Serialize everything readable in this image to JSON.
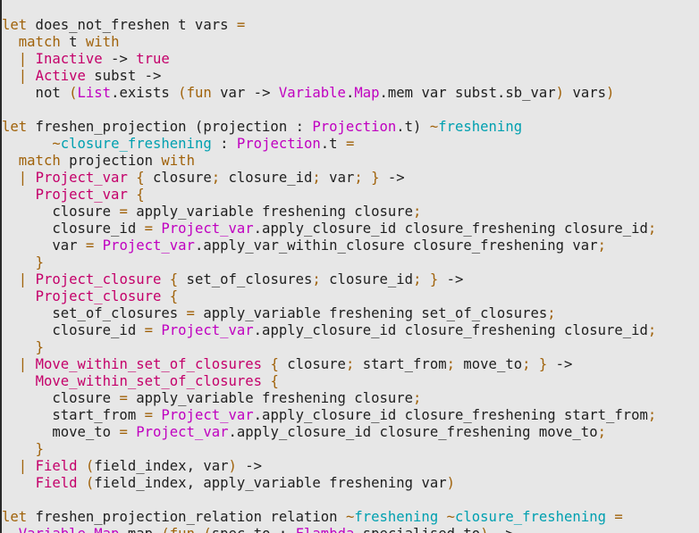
{
  "editor": {
    "title": "",
    "colors": {
      "background": "#e7e7e7",
      "keyword": "#a0620a",
      "constructor": "#c4006a",
      "module": "#c000c0",
      "label": "#00a0b0",
      "plain": "#202020"
    },
    "lines": [
      [
        [
          "kw",
          "let"
        ],
        [
          "plain",
          " does_not_freshen t vars "
        ],
        [
          "kw",
          "="
        ]
      ],
      [
        [
          "plain",
          "  "
        ],
        [
          "kw",
          "match"
        ],
        [
          "plain",
          " t "
        ],
        [
          "kw",
          "with"
        ]
      ],
      [
        [
          "plain",
          "  "
        ],
        [
          "kw",
          "|"
        ],
        [
          "plain",
          " "
        ],
        [
          "ctor",
          "Inactive"
        ],
        [
          "plain",
          " -> "
        ],
        [
          "ctor",
          "true"
        ]
      ],
      [
        [
          "plain",
          "  "
        ],
        [
          "kw",
          "|"
        ],
        [
          "plain",
          " "
        ],
        [
          "ctor",
          "Active"
        ],
        [
          "plain",
          " subst ->"
        ]
      ],
      [
        [
          "plain",
          "    not "
        ],
        [
          "kw",
          "("
        ],
        [
          "mod",
          "List"
        ],
        [
          "plain",
          ".exists "
        ],
        [
          "kw",
          "("
        ],
        [
          "kw",
          "fun"
        ],
        [
          "plain",
          " var -> "
        ],
        [
          "mod",
          "Variable"
        ],
        [
          "plain",
          "."
        ],
        [
          "mod",
          "Map"
        ],
        [
          "plain",
          ".mem var subst.sb_var"
        ],
        [
          "kw",
          ")"
        ],
        [
          "plain",
          " vars"
        ],
        [
          "kw",
          ")"
        ]
      ],
      [
        [
          "plain",
          ""
        ]
      ],
      [
        [
          "kw",
          "let"
        ],
        [
          "plain",
          " freshen_projection (projection : "
        ],
        [
          "mod",
          "Projection"
        ],
        [
          "plain",
          ".t) "
        ],
        [
          "kw",
          "~"
        ],
        [
          "label",
          "freshening"
        ]
      ],
      [
        [
          "plain",
          "      "
        ],
        [
          "kw",
          "~"
        ],
        [
          "label",
          "closure_freshening"
        ],
        [
          "plain",
          " : "
        ],
        [
          "mod",
          "Projection"
        ],
        [
          "plain",
          ".t "
        ],
        [
          "kw",
          "="
        ]
      ],
      [
        [
          "plain",
          "  "
        ],
        [
          "kw",
          "match"
        ],
        [
          "plain",
          " projection "
        ],
        [
          "kw",
          "with"
        ]
      ],
      [
        [
          "plain",
          "  "
        ],
        [
          "kw",
          "|"
        ],
        [
          "plain",
          " "
        ],
        [
          "ctor",
          "Project_var"
        ],
        [
          "plain",
          " "
        ],
        [
          "kw",
          "{"
        ],
        [
          "plain",
          " closure"
        ],
        [
          "kw",
          ";"
        ],
        [
          "plain",
          " closure_id"
        ],
        [
          "kw",
          ";"
        ],
        [
          "plain",
          " var"
        ],
        [
          "kw",
          ";"
        ],
        [
          "plain",
          " "
        ],
        [
          "kw",
          "}"
        ],
        [
          "plain",
          " ->"
        ]
      ],
      [
        [
          "plain",
          "    "
        ],
        [
          "ctor",
          "Project_var"
        ],
        [
          "plain",
          " "
        ],
        [
          "kw",
          "{"
        ]
      ],
      [
        [
          "plain",
          "      closure "
        ],
        [
          "kw",
          "="
        ],
        [
          "plain",
          " apply_variable freshening closure"
        ],
        [
          "kw",
          ";"
        ]
      ],
      [
        [
          "plain",
          "      closure_id "
        ],
        [
          "kw",
          "="
        ],
        [
          "plain",
          " "
        ],
        [
          "mod",
          "Project_var"
        ],
        [
          "plain",
          ".apply_closure_id closure_freshening closure_id"
        ],
        [
          "kw",
          ";"
        ]
      ],
      [
        [
          "plain",
          "      var "
        ],
        [
          "kw",
          "="
        ],
        [
          "plain",
          " "
        ],
        [
          "mod",
          "Project_var"
        ],
        [
          "plain",
          ".apply_var_within_closure closure_freshening var"
        ],
        [
          "kw",
          ";"
        ]
      ],
      [
        [
          "plain",
          "    "
        ],
        [
          "kw",
          "}"
        ]
      ],
      [
        [
          "plain",
          "  "
        ],
        [
          "kw",
          "|"
        ],
        [
          "plain",
          " "
        ],
        [
          "ctor",
          "Project_closure"
        ],
        [
          "plain",
          " "
        ],
        [
          "kw",
          "{"
        ],
        [
          "plain",
          " set_of_closures"
        ],
        [
          "kw",
          ";"
        ],
        [
          "plain",
          " closure_id"
        ],
        [
          "kw",
          ";"
        ],
        [
          "plain",
          " "
        ],
        [
          "kw",
          "}"
        ],
        [
          "plain",
          " ->"
        ]
      ],
      [
        [
          "plain",
          "    "
        ],
        [
          "ctor",
          "Project_closure"
        ],
        [
          "plain",
          " "
        ],
        [
          "kw",
          "{"
        ]
      ],
      [
        [
          "plain",
          "      set_of_closures "
        ],
        [
          "kw",
          "="
        ],
        [
          "plain",
          " apply_variable freshening set_of_closures"
        ],
        [
          "kw",
          ";"
        ]
      ],
      [
        [
          "plain",
          "      closure_id "
        ],
        [
          "kw",
          "="
        ],
        [
          "plain",
          " "
        ],
        [
          "mod",
          "Project_var"
        ],
        [
          "plain",
          ".apply_closure_id closure_freshening closure_id"
        ],
        [
          "kw",
          ";"
        ]
      ],
      [
        [
          "plain",
          "    "
        ],
        [
          "kw",
          "}"
        ]
      ],
      [
        [
          "plain",
          "  "
        ],
        [
          "kw",
          "|"
        ],
        [
          "plain",
          " "
        ],
        [
          "ctor",
          "Move_within_set_of_closures"
        ],
        [
          "plain",
          " "
        ],
        [
          "kw",
          "{"
        ],
        [
          "plain",
          " closure"
        ],
        [
          "kw",
          ";"
        ],
        [
          "plain",
          " start_from"
        ],
        [
          "kw",
          ";"
        ],
        [
          "plain",
          " move_to"
        ],
        [
          "kw",
          ";"
        ],
        [
          "plain",
          " "
        ],
        [
          "kw",
          "}"
        ],
        [
          "plain",
          " ->"
        ]
      ],
      [
        [
          "plain",
          "    "
        ],
        [
          "ctor",
          "Move_within_set_of_closures"
        ],
        [
          "plain",
          " "
        ],
        [
          "kw",
          "{"
        ]
      ],
      [
        [
          "plain",
          "      closure "
        ],
        [
          "kw",
          "="
        ],
        [
          "plain",
          " apply_variable freshening closure"
        ],
        [
          "kw",
          ";"
        ]
      ],
      [
        [
          "plain",
          "      start_from "
        ],
        [
          "kw",
          "="
        ],
        [
          "plain",
          " "
        ],
        [
          "mod",
          "Project_var"
        ],
        [
          "plain",
          ".apply_closure_id closure_freshening start_from"
        ],
        [
          "kw",
          ";"
        ]
      ],
      [
        [
          "plain",
          "      move_to "
        ],
        [
          "kw",
          "="
        ],
        [
          "plain",
          " "
        ],
        [
          "mod",
          "Project_var"
        ],
        [
          "plain",
          ".apply_closure_id closure_freshening move_to"
        ],
        [
          "kw",
          ";"
        ]
      ],
      [
        [
          "plain",
          "    "
        ],
        [
          "kw",
          "}"
        ]
      ],
      [
        [
          "plain",
          "  "
        ],
        [
          "kw",
          "|"
        ],
        [
          "plain",
          " "
        ],
        [
          "ctor",
          "Field"
        ],
        [
          "plain",
          " "
        ],
        [
          "kw",
          "("
        ],
        [
          "plain",
          "field_index, var"
        ],
        [
          "kw",
          ")"
        ],
        [
          "plain",
          " ->"
        ]
      ],
      [
        [
          "plain",
          "    "
        ],
        [
          "ctor",
          "Field"
        ],
        [
          "plain",
          " "
        ],
        [
          "kw",
          "("
        ],
        [
          "plain",
          "field_index, apply_variable freshening var"
        ],
        [
          "kw",
          ")"
        ]
      ],
      [
        [
          "plain",
          ""
        ]
      ],
      [
        [
          "kw",
          "let"
        ],
        [
          "plain",
          " freshen_projection_relation relation "
        ],
        [
          "kw",
          "~"
        ],
        [
          "label",
          "freshening"
        ],
        [
          "plain",
          " "
        ],
        [
          "kw",
          "~"
        ],
        [
          "label",
          "closure_freshening"
        ],
        [
          "plain",
          " "
        ],
        [
          "kw",
          "="
        ]
      ],
      [
        [
          "plain",
          "  "
        ],
        [
          "mod",
          "Variable"
        ],
        [
          "plain",
          "."
        ],
        [
          "mod",
          "Map"
        ],
        [
          "plain",
          ".map "
        ],
        [
          "kw",
          "("
        ],
        [
          "kw",
          "fun"
        ],
        [
          "plain",
          " "
        ],
        [
          "kw",
          "("
        ],
        [
          "plain",
          "spec_to : "
        ],
        [
          "mod",
          "Flambda"
        ],
        [
          "plain",
          ".specialised_to"
        ],
        [
          "kw",
          ")"
        ],
        [
          "plain",
          " ->"
        ]
      ]
    ]
  }
}
